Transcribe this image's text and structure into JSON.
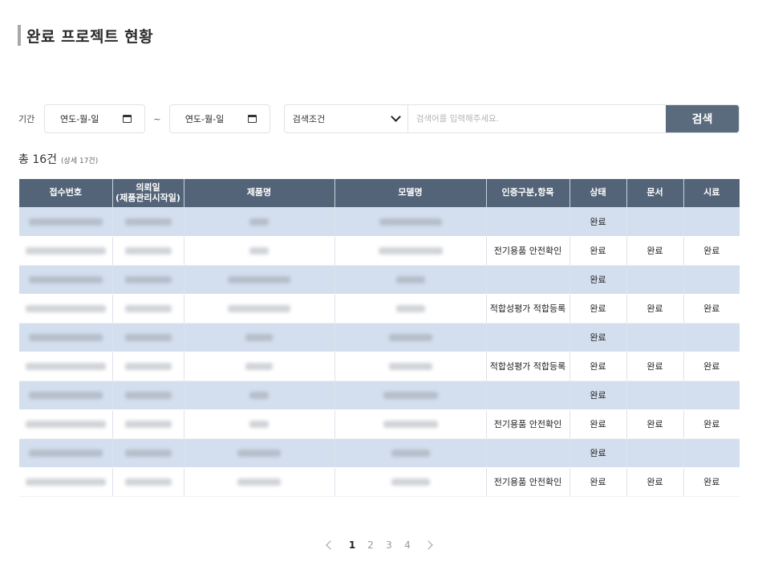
{
  "page": {
    "title": "완료 프로젝트 현황"
  },
  "filter": {
    "period_label": "기간",
    "start_date": "연도-월-일",
    "end_date": "연도-월-일",
    "tilde": "~",
    "condition_value": "검색조건",
    "search_placeholder": "검색어를 입력해주세요.",
    "search_button": "검색"
  },
  "summary": {
    "total": "총 16건",
    "detail": "(상세 17건)"
  },
  "table": {
    "headers": [
      "접수번호",
      "의뢰일\n(제품관리시작일)",
      "제품명",
      "모델명",
      "인증구분,항목",
      "상태",
      "문서",
      "시료"
    ],
    "rows": [
      {
        "cert": "",
        "status": "완료",
        "doc": "",
        "sample": ""
      },
      {
        "cert": "전기용품 안전확인",
        "status": "완료",
        "doc": "완료",
        "sample": "완료"
      },
      {
        "cert": "",
        "status": "완료",
        "doc": "",
        "sample": ""
      },
      {
        "cert": "적합성평가 적합등록",
        "status": "완료",
        "doc": "완료",
        "sample": "완료"
      },
      {
        "cert": "",
        "status": "완료",
        "doc": "",
        "sample": ""
      },
      {
        "cert": "적합성평가 적합등록",
        "status": "완료",
        "doc": "완료",
        "sample": "완료"
      },
      {
        "cert": "",
        "status": "완료",
        "doc": "",
        "sample": ""
      },
      {
        "cert": "전기용품 안전확인",
        "status": "완료",
        "doc": "완료",
        "sample": "완료"
      },
      {
        "cert": "",
        "status": "완료",
        "doc": "",
        "sample": ""
      },
      {
        "cert": "전기용품 안전확인",
        "status": "완료",
        "doc": "완료",
        "sample": "완료"
      }
    ]
  },
  "pagination": {
    "pages": [
      "1",
      "2",
      "3",
      "4"
    ],
    "current": "1"
  },
  "icons": {
    "calendar": "calendar-icon",
    "dropdown": "chevron-down-icon",
    "prev": "chevron-left-icon",
    "next": "chevron-right-icon"
  }
}
